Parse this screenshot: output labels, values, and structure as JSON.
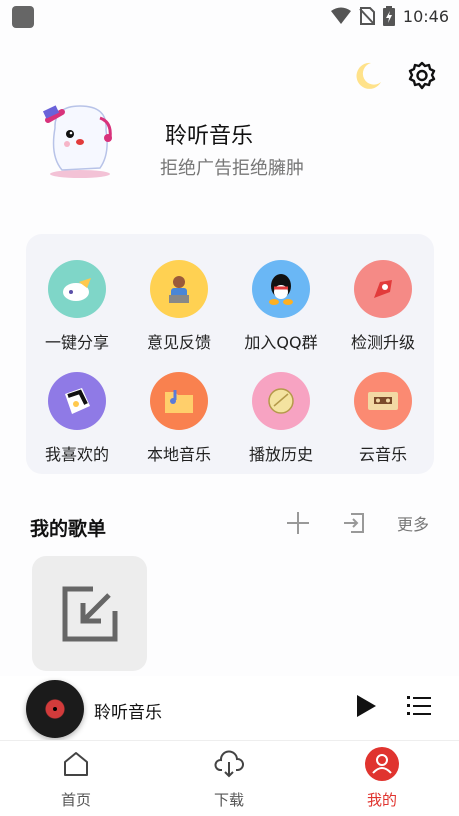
{
  "status_bar": {
    "time": "10:46"
  },
  "header": {
    "moon_icon": "moon-icon",
    "settings_icon": "gear-icon"
  },
  "profile": {
    "name": "聆听音乐",
    "subtitle": "拒绝广告拒绝臃肿"
  },
  "grid": [
    {
      "label": "一键分享",
      "icon": "share-icon",
      "color": "#7fd6c8"
    },
    {
      "label": "意见反馈",
      "icon": "feedback-icon",
      "color": "#ffd152"
    },
    {
      "label": "加入QQ群",
      "icon": "qq-icon",
      "color": "#6ab7f5"
    },
    {
      "label": "检测升级",
      "icon": "upgrade-icon",
      "color": "#f58a86"
    },
    {
      "label": "我喜欢的",
      "icon": "favorite-icon",
      "color": "#8f7ae6"
    },
    {
      "label": "本地音乐",
      "icon": "local-music-icon",
      "color": "#f9814f"
    },
    {
      "label": "播放历史",
      "icon": "history-icon",
      "color": "#f7a3c2"
    },
    {
      "label": "云音乐",
      "icon": "cloud-music-icon",
      "color": "#fb8a72"
    }
  ],
  "playlists": {
    "title": "我的歌单",
    "more": "更多"
  },
  "player": {
    "title": "聆听音乐"
  },
  "tabs": [
    {
      "label": "首页",
      "icon": "home-icon"
    },
    {
      "label": "下载",
      "icon": "download-icon"
    },
    {
      "label": "我的",
      "icon": "profile-icon"
    }
  ],
  "colors": {
    "accent": "#e0342f",
    "card": "#f3f4f9"
  }
}
